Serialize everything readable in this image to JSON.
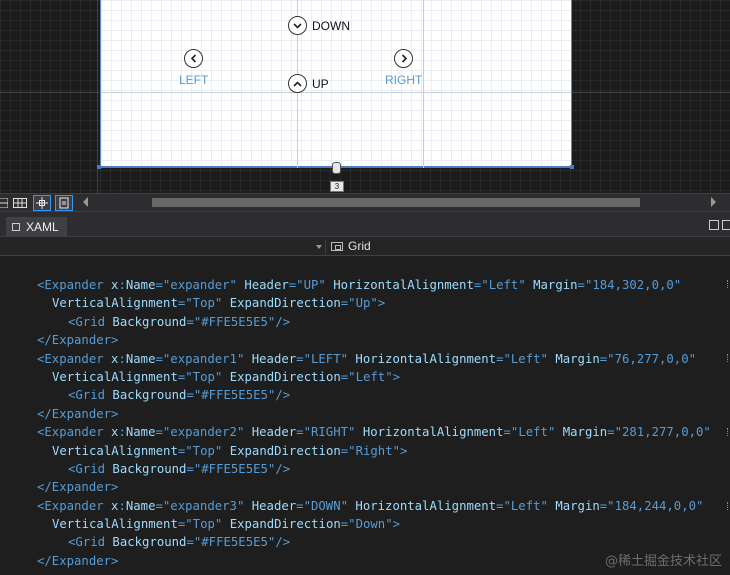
{
  "designer": {
    "expanders": {
      "down": {
        "label": "DOWN"
      },
      "left": {
        "label": "LEFT"
      },
      "up": {
        "label": "UP"
      },
      "right": {
        "label": "RIGHT"
      }
    },
    "resize_value": "3"
  },
  "document_tab": {
    "label": "XAML"
  },
  "navigation": {
    "element": "Grid"
  },
  "code": [
    {
      "parts": [
        [
          "t",
          "<Expander "
        ],
        [
          "a",
          "x"
        ],
        [
          "t",
          ":"
        ],
        [
          "a",
          "Name"
        ],
        [
          "t",
          "=\""
        ],
        [
          "v",
          "expander"
        ],
        [
          "t",
          "\" "
        ],
        [
          "a",
          "Header"
        ],
        [
          "t",
          "=\""
        ],
        [
          "v",
          "UP"
        ],
        [
          "t",
          "\" "
        ],
        [
          "a",
          "HorizontalAlignment"
        ],
        [
          "t",
          "=\""
        ],
        [
          "v",
          "Left"
        ],
        [
          "t",
          "\" "
        ],
        [
          "a",
          "Margin"
        ],
        [
          "t",
          "=\""
        ],
        [
          "v",
          "184,302,0,0"
        ],
        [
          "t",
          "\""
        ]
      ]
    },
    {
      "parts": [
        [
          "a",
          "VerticalAlignment"
        ],
        [
          "t",
          "=\""
        ],
        [
          "v",
          "Top"
        ],
        [
          "t",
          "\" "
        ],
        [
          "a",
          "ExpandDirection"
        ],
        [
          "t",
          "=\""
        ],
        [
          "v",
          "Up"
        ],
        [
          "t",
          "\">"
        ]
      ]
    },
    {
      "parts": [
        [
          "t",
          "<Grid "
        ],
        [
          "a",
          "Background"
        ],
        [
          "t",
          "=\""
        ],
        [
          "v",
          "#FFE5E5E5"
        ],
        [
          "t",
          "\"/>"
        ]
      ]
    },
    {
      "parts": [
        [
          "t",
          "</Expander>"
        ]
      ]
    },
    {
      "parts": [
        [
          "t",
          "<Expander "
        ],
        [
          "a",
          "x"
        ],
        [
          "t",
          ":"
        ],
        [
          "a",
          "Name"
        ],
        [
          "t",
          "=\""
        ],
        [
          "v",
          "expander1"
        ],
        [
          "t",
          "\" "
        ],
        [
          "a",
          "Header"
        ],
        [
          "t",
          "=\""
        ],
        [
          "v",
          "LEFT"
        ],
        [
          "t",
          "\" "
        ],
        [
          "a",
          "HorizontalAlignment"
        ],
        [
          "t",
          "=\""
        ],
        [
          "v",
          "Left"
        ],
        [
          "t",
          "\" "
        ],
        [
          "a",
          "Margin"
        ],
        [
          "t",
          "=\""
        ],
        [
          "v",
          "76,277,0,0"
        ],
        [
          "t",
          "\""
        ]
      ]
    },
    {
      "parts": [
        [
          "a",
          "VerticalAlignment"
        ],
        [
          "t",
          "=\""
        ],
        [
          "v",
          "Top"
        ],
        [
          "t",
          "\" "
        ],
        [
          "a",
          "ExpandDirection"
        ],
        [
          "t",
          "=\""
        ],
        [
          "v",
          "Left"
        ],
        [
          "t",
          "\">"
        ]
      ]
    },
    {
      "parts": [
        [
          "t",
          "<Grid "
        ],
        [
          "a",
          "Background"
        ],
        [
          "t",
          "=\""
        ],
        [
          "v",
          "#FFE5E5E5"
        ],
        [
          "t",
          "\"/>"
        ]
      ]
    },
    {
      "parts": [
        [
          "t",
          "</Expander>"
        ]
      ]
    },
    {
      "parts": [
        [
          "t",
          "<Expander "
        ],
        [
          "a",
          "x"
        ],
        [
          "t",
          ":"
        ],
        [
          "a",
          "Name"
        ],
        [
          "t",
          "=\""
        ],
        [
          "v",
          "expander2"
        ],
        [
          "t",
          "\" "
        ],
        [
          "a",
          "Header"
        ],
        [
          "t",
          "=\""
        ],
        [
          "v",
          "RIGHT"
        ],
        [
          "t",
          "\" "
        ],
        [
          "a",
          "HorizontalAlignment"
        ],
        [
          "t",
          "=\""
        ],
        [
          "v",
          "Left"
        ],
        [
          "t",
          "\" "
        ],
        [
          "a",
          "Margin"
        ],
        [
          "t",
          "=\""
        ],
        [
          "v",
          "281,277,0,0"
        ],
        [
          "t",
          "\""
        ]
      ]
    },
    {
      "parts": [
        [
          "a",
          "VerticalAlignment"
        ],
        [
          "t",
          "=\""
        ],
        [
          "v",
          "Top"
        ],
        [
          "t",
          "\" "
        ],
        [
          "a",
          "ExpandDirection"
        ],
        [
          "t",
          "=\""
        ],
        [
          "v",
          "Right"
        ],
        [
          "t",
          "\">"
        ]
      ]
    },
    {
      "parts": [
        [
          "t",
          "<Grid "
        ],
        [
          "a",
          "Background"
        ],
        [
          "t",
          "=\""
        ],
        [
          "v",
          "#FFE5E5E5"
        ],
        [
          "t",
          "\"/>"
        ]
      ]
    },
    {
      "parts": [
        [
          "t",
          "</Expander>"
        ]
      ]
    },
    {
      "parts": [
        [
          "t",
          "<Expander "
        ],
        [
          "a",
          "x"
        ],
        [
          "t",
          ":"
        ],
        [
          "a",
          "Name"
        ],
        [
          "t",
          "=\""
        ],
        [
          "v",
          "expander3"
        ],
        [
          "t",
          "\" "
        ],
        [
          "a",
          "Header"
        ],
        [
          "t",
          "=\""
        ],
        [
          "v",
          "DOWN"
        ],
        [
          "t",
          "\" "
        ],
        [
          "a",
          "HorizontalAlignment"
        ],
        [
          "t",
          "=\""
        ],
        [
          "v",
          "Left"
        ],
        [
          "t",
          "\" "
        ],
        [
          "a",
          "Margin"
        ],
        [
          "t",
          "=\""
        ],
        [
          "v",
          "184,244,0,0"
        ],
        [
          "t",
          "\""
        ]
      ]
    },
    {
      "parts": [
        [
          "a",
          "VerticalAlignment"
        ],
        [
          "t",
          "=\""
        ],
        [
          "v",
          "Top"
        ],
        [
          "t",
          "\" "
        ],
        [
          "a",
          "ExpandDirection"
        ],
        [
          "t",
          "=\""
        ],
        [
          "v",
          "Down"
        ],
        [
          "t",
          "\">"
        ]
      ]
    },
    {
      "parts": [
        [
          "t",
          "<Grid "
        ],
        [
          "a",
          "Background"
        ],
        [
          "t",
          "=\""
        ],
        [
          "v",
          "#FFE5E5E5"
        ],
        [
          "t",
          "\"/>"
        ]
      ]
    },
    {
      "parts": [
        [
          "t",
          "</Expander>"
        ]
      ]
    }
  ],
  "watermark": "@稀土掘金技术社区",
  "colors": {
    "editor_bg": "#1e1e1e",
    "keyword": "#569cd6",
    "attribute": "#9cdcfe",
    "selection_accent": "#3399ff"
  },
  "icons": {
    "toolbar": [
      "grid-view-icon",
      "snap-grid-icon",
      "snap-lines-icon",
      "artboard-icon"
    ],
    "expander_toggle_icons": [
      "chevron-down-icon",
      "chevron-left-icon",
      "chevron-up-icon",
      "chevron-right-icon"
    ]
  }
}
